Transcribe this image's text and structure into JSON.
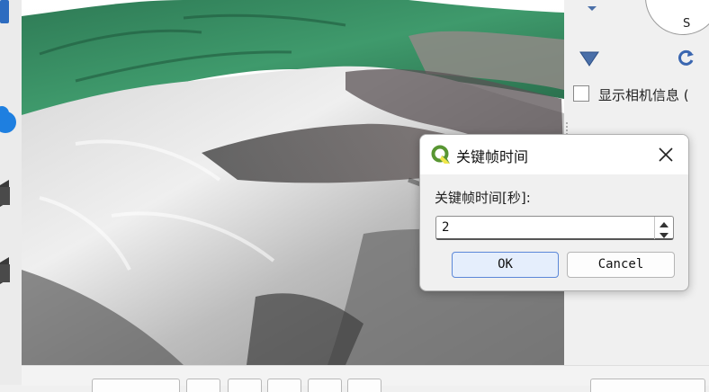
{
  "compass": {
    "south_label": "S"
  },
  "camera_info": {
    "label": "显示相机信息 (",
    "checked": false
  },
  "dialog": {
    "title": "关键帧时间",
    "field_label": "关键帧时间[秒]:",
    "value": "2",
    "ok_label": "OK",
    "cancel_label": "Cancel"
  },
  "colors": {
    "accent": "#5b87d8",
    "qgis_green": "#589632",
    "nav_blue": "#4a6fa8"
  },
  "icons": {
    "close": "close-icon",
    "qgis": "qgis-logo-icon",
    "tilt_down": "triangle-down-icon",
    "reset_view": "rotate-reset-icon"
  }
}
